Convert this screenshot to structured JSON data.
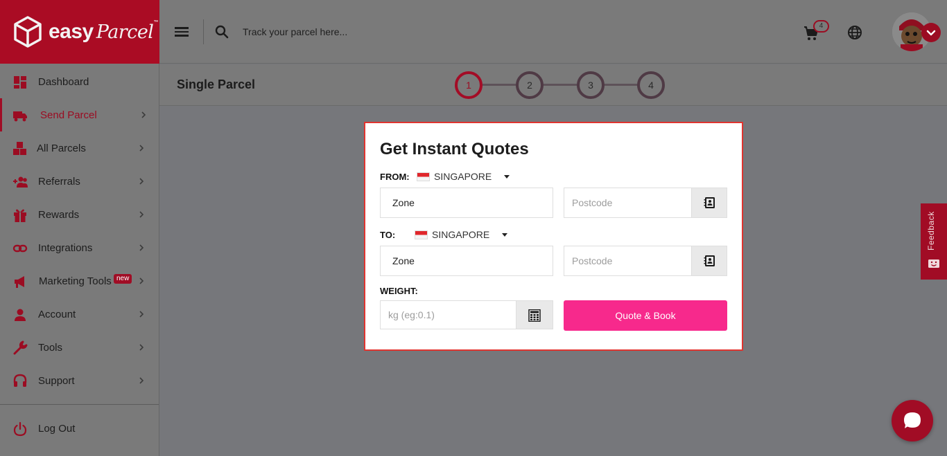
{
  "brand": {
    "logo_text": "easy",
    "logo_script": "Parcel",
    "trademark": "™"
  },
  "topbar": {
    "search_placeholder": "Track your parcel here...",
    "cart_count": "4"
  },
  "sidebar": {
    "items": [
      {
        "label": "Dashboard",
        "icon": "dashboard-icon"
      },
      {
        "label": "Send Parcel",
        "icon": "truck-icon",
        "active": true
      },
      {
        "label": "All Parcels",
        "icon": "boxes-icon"
      },
      {
        "label": "Referrals",
        "icon": "users-plus-icon"
      },
      {
        "label": "Rewards",
        "icon": "gift-icon"
      },
      {
        "label": "Integrations",
        "icon": "link-icon"
      },
      {
        "label": "Marketing Tools",
        "icon": "megaphone-icon",
        "badge": "new"
      },
      {
        "label": "Account",
        "icon": "user-icon"
      },
      {
        "label": "Tools",
        "icon": "wrench-icon"
      },
      {
        "label": "Support",
        "icon": "headset-icon"
      }
    ],
    "logout": "Log Out"
  },
  "steps": {
    "title": "Single Parcel",
    "items": [
      "1",
      "2",
      "3",
      "4"
    ],
    "active": "1"
  },
  "quote": {
    "title": "Get Instant Quotes",
    "from_label": "FROM:",
    "from_country": "SINGAPORE",
    "from_zone": "Zone",
    "from_postcode_placeholder": "Postcode",
    "to_label": "TO:",
    "to_country": "SINGAPORE",
    "to_zone": "Zone",
    "to_postcode_placeholder": "Postcode",
    "weight_label": "WEIGHT:",
    "weight_placeholder": "kg (eg:0.1)",
    "button": "Quote & Book"
  },
  "feedback": {
    "label": "Feedback"
  },
  "colors": {
    "brand": "#aa0c24",
    "button": "#f7298c",
    "modal_border": "#e0342f"
  }
}
